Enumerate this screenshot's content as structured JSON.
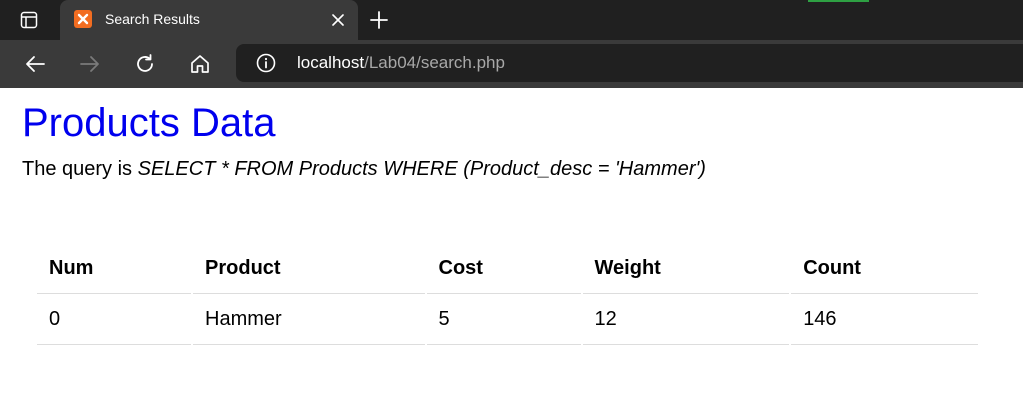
{
  "browser": {
    "tab": {
      "title": "Search Results",
      "favicon": "xampp-logo-icon",
      "accent_color": "#f26d21"
    },
    "address": {
      "host": "localhost",
      "path": "/Lab04/search.php"
    },
    "icons": {
      "tab_actions": "tab-actions-icon",
      "close": "close-icon",
      "new_tab": "plus-icon",
      "back": "back-arrow-icon",
      "forward": "forward-arrow-icon",
      "refresh": "refresh-icon",
      "home": "home-icon",
      "site_info": "info-icon"
    }
  },
  "page": {
    "title": "Products Data",
    "title_color": "#0000ee",
    "query_prefix": "The query is",
    "query": "SELECT * FROM Products WHERE (Product_desc = 'Hammer')"
  },
  "table": {
    "headers": [
      "Num",
      "Product",
      "Cost",
      "Weight",
      "Count"
    ],
    "rows": [
      [
        "0",
        "Hammer",
        "5",
        "12",
        "146"
      ]
    ]
  }
}
